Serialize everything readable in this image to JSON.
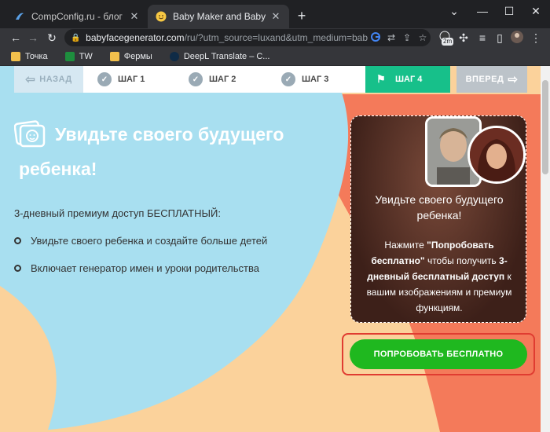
{
  "browser": {
    "tabs": [
      {
        "title": "CompConfig.ru - блог о настрой",
        "icon": "compconfig-favicon",
        "active": false
      },
      {
        "title": "Baby Maker and Baby Face gene",
        "icon": "smiley-favicon",
        "active": true
      }
    ],
    "new_tab_label": "+",
    "address": {
      "host": "babyfacegenerator.com",
      "path": "/ru/?utm_source=luxand&utm_medium=baby..."
    },
    "bookmarks": [
      {
        "label": "Точка",
        "icon": "folder-icon"
      },
      {
        "label": "TW",
        "icon": "tw-icon"
      },
      {
        "label": "Фермы",
        "icon": "folder-icon"
      },
      {
        "label": "DeepL Translate – C...",
        "icon": "deepl-icon"
      }
    ],
    "extension_badge": "2m",
    "colors": {
      "chrome_bg": "#202124",
      "toolbar_bg": "#35363a"
    }
  },
  "steps_bar": {
    "back_label": "НАЗАД",
    "next_label": "ВПЕРЕД",
    "steps": [
      {
        "label": "ШАГ 1",
        "done": true
      },
      {
        "label": "ШАГ 2",
        "done": true
      },
      {
        "label": "ШАГ 3",
        "done": true
      },
      {
        "label": "ШАГ 4",
        "active": true
      }
    ],
    "colors": {
      "active": "#17c08a",
      "back": "#d6e8f2",
      "next": "#bcc3c9"
    }
  },
  "hero": {
    "title_line1": "Увидьте своего будущего",
    "title_line2": "ребенка!",
    "premium_text": "3-дневный премиум доступ БЕСПЛАТНЫЙ:",
    "bullets": [
      "Увидьте своего ребенка и создайте больше детей",
      "Включает генератор имен и уроки родительства"
    ]
  },
  "promo_card": {
    "title": "Увидьте своего будущего ребенка!",
    "text_prefix": "Нажмите ",
    "text_bold1": "\"Попробовать бесплатно\"",
    "text_mid": " чтобы получить ",
    "text_bold2": "3-дневный бесплатный доступ",
    "text_suffix": " к вашим изображениям и премиум функциям."
  },
  "cta": {
    "label": "ПОПРОБОВАТЬ БЕСПЛАТНО",
    "color": "#1fb81f",
    "highlight_color": "#e03c31"
  },
  "page_colors": {
    "blue": "#a8dff0",
    "coral": "#f47a5a",
    "peach": "#fbd29b"
  }
}
